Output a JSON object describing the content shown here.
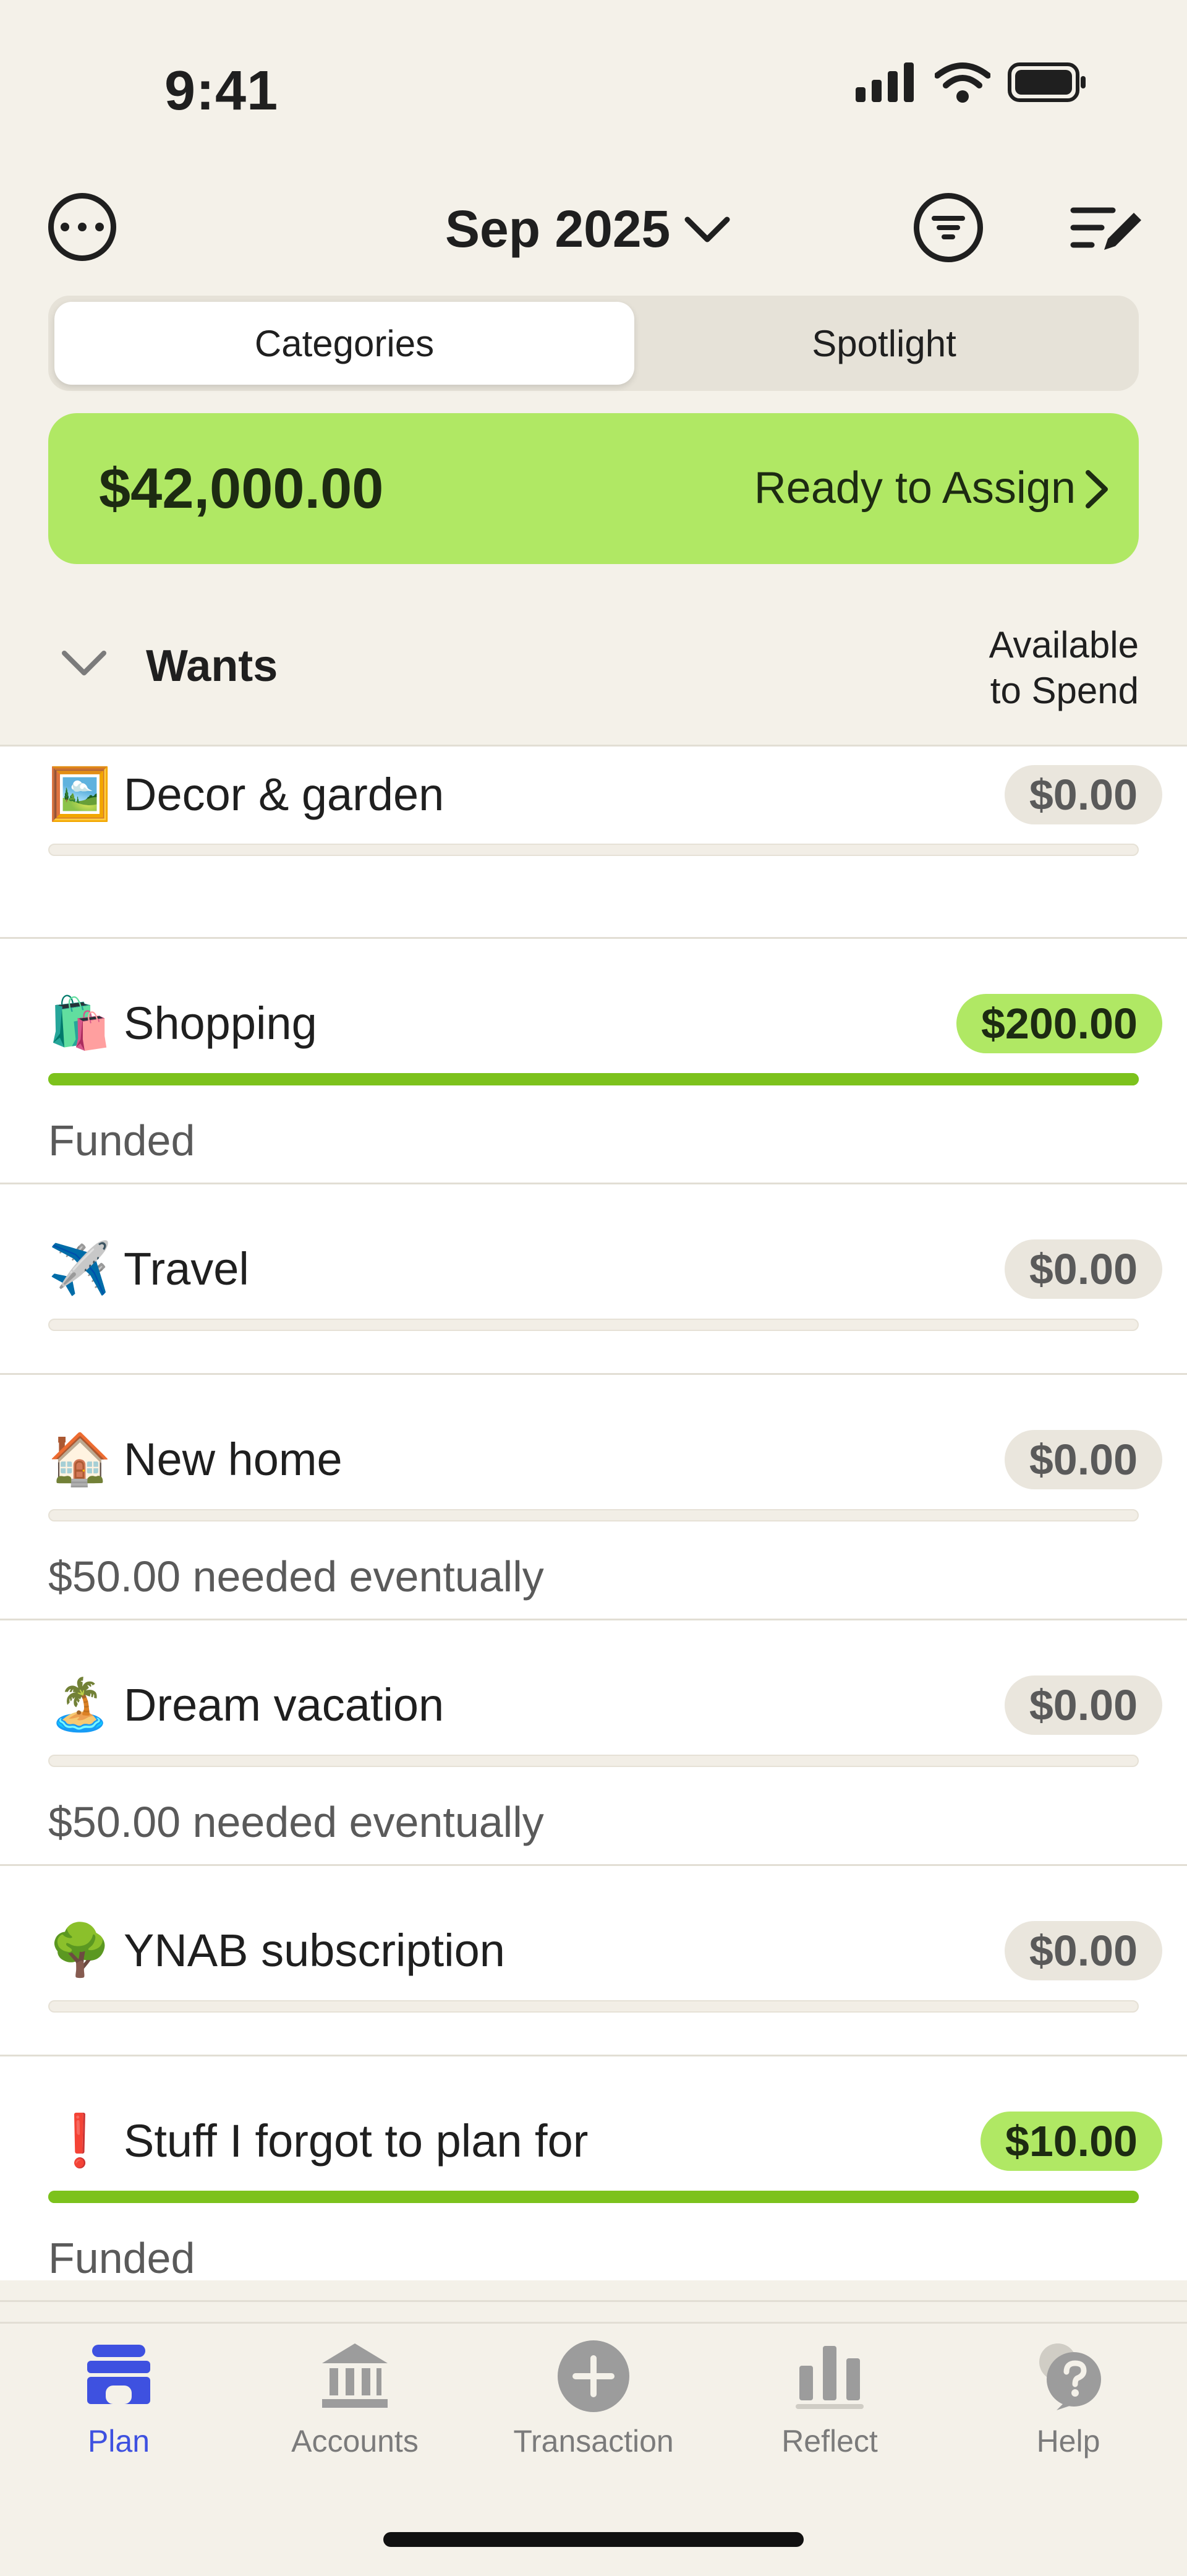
{
  "status": {
    "time": "9:41"
  },
  "header": {
    "month": "Sep 2025"
  },
  "segmented": {
    "categories": "Categories",
    "spotlight": "Spotlight"
  },
  "ready": {
    "amount": "$42,000.00",
    "label": "Ready to Assign"
  },
  "group": {
    "title": "Wants",
    "column_line1": "Available",
    "column_line2": "to Spend"
  },
  "rows": [
    {
      "emoji": "🖼️",
      "name": "Decor & garden",
      "amount": "$0.00",
      "progress": 0,
      "status": ""
    },
    {
      "emoji": "🛍️",
      "name": "Shopping",
      "amount": "$200.00",
      "progress": 100,
      "status": "Funded"
    },
    {
      "emoji": "✈️",
      "name": "Travel",
      "amount": "$0.00",
      "progress": 0,
      "status": ""
    },
    {
      "emoji": "🏠",
      "name": "New home",
      "amount": "$0.00",
      "progress": 0,
      "status": "$50.00 needed eventually"
    },
    {
      "emoji": "🏝️",
      "name": "Dream vacation",
      "amount": "$0.00",
      "progress": 0,
      "status": "$50.00 needed eventually"
    },
    {
      "emoji": "🌳",
      "name": "YNAB subscription",
      "amount": "$0.00",
      "progress": 0,
      "status": ""
    },
    {
      "emoji": "❗",
      "name": "Stuff I forgot to plan for",
      "amount": "$10.00",
      "progress": 100,
      "status": "Funded"
    }
  ],
  "tabs": [
    {
      "label": "Plan",
      "icon": "plan-icon",
      "active": true
    },
    {
      "label": "Accounts",
      "icon": "bank-icon",
      "active": false
    },
    {
      "label": "Transaction",
      "icon": "plus-circle-icon",
      "active": false
    },
    {
      "label": "Reflect",
      "icon": "bar-chart-icon",
      "active": false
    },
    {
      "label": "Help",
      "icon": "help-bubble-icon",
      "active": false
    }
  ],
  "colors": {
    "accent": "#B0E864",
    "funded_bar": "#7CC21C",
    "active_tab": "#3E51E0"
  }
}
